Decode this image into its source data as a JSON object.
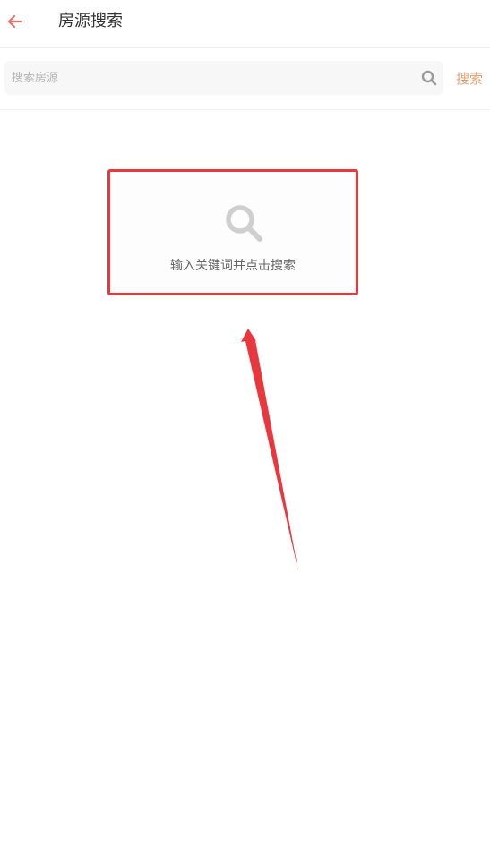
{
  "header": {
    "back_icon": "arrow-left-icon",
    "title": "房源搜索"
  },
  "search": {
    "placeholder": "搜索房源",
    "value": "",
    "icon": "search-icon",
    "button_label": "搜索"
  },
  "empty_state": {
    "icon": "search-icon",
    "message": "输入关键词并点击搜索"
  },
  "annotation": {
    "highlight_color": "#e8383d",
    "arrow_color": "#e8383d"
  },
  "colors": {
    "accent": "#e8a071",
    "back_arrow": "#e8736a",
    "icon_gray": "#cfcfcf"
  }
}
